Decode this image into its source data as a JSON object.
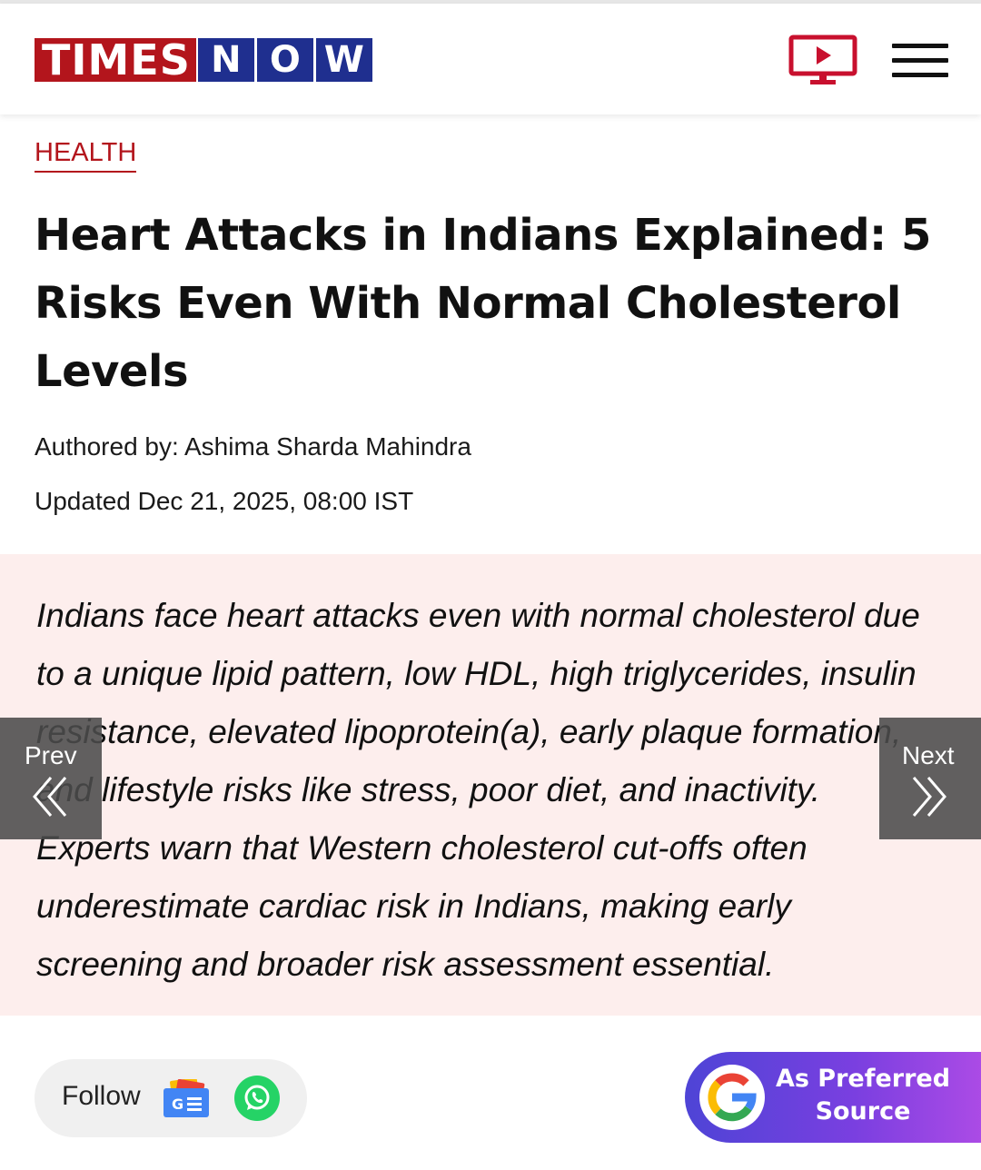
{
  "header": {
    "logo_primary": "TIMES",
    "logo_letters": [
      "N",
      "O",
      "W"
    ],
    "tv_icon": "live-tv-icon",
    "menu_icon": "hamburger-menu-icon"
  },
  "article": {
    "category": "HEALTH",
    "headline": "Heart Attacks in Indians Explained: 5 Risks Even With Normal Cholesterol Levels",
    "author": "Authored by: Ashima Sharda Mahindra",
    "updated": "Updated Dec 21, 2025, 08:00 IST",
    "summary": "Indians face heart attacks even with normal cholesterol due to a unique lipid pattern, low HDL, high triglycerides, insulin resistance, elevated lipoprotein(a), early plaque formation, and lifestyle risks like stress, poor diet, and inactivity. Experts warn that Western cholesterol cut-offs often underestimate cardiac risk in Indians, making early screening and broader risk assessment essential."
  },
  "navigation": {
    "prev_label": "Prev",
    "next_label": "Next"
  },
  "follow": {
    "label": "Follow",
    "icons": [
      "google-news-icon",
      "whatsapp-icon"
    ]
  },
  "preferred_source": {
    "line1": "As Preferred",
    "line2": "Source",
    "icon": "google-g-icon"
  },
  "colors": {
    "brand_red": "#b3151c",
    "brand_blue": "#1f2f8f",
    "summary_bg": "#fdeeed",
    "whatsapp_green": "#25d366"
  }
}
